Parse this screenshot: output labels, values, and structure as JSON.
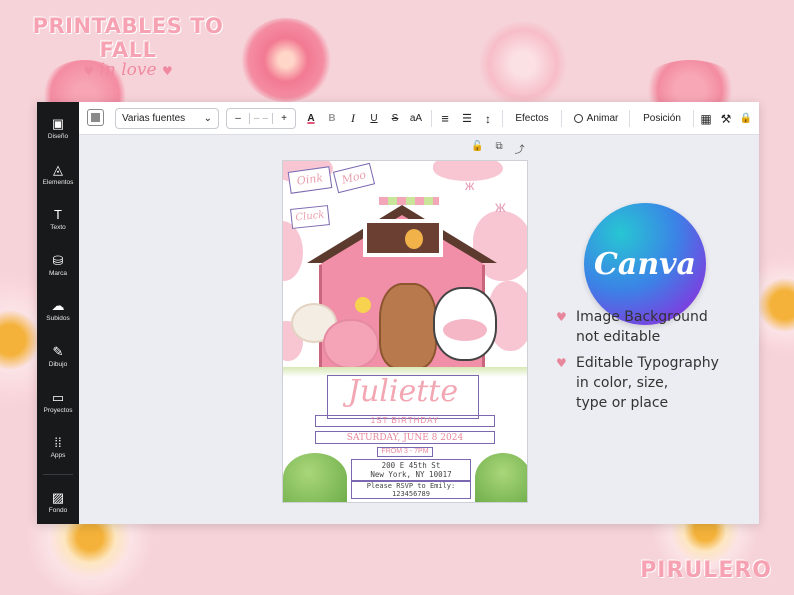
{
  "brand": {
    "line1": "PRINTABLES TO FALL",
    "line2": "in love",
    "heart": "♥"
  },
  "signature": "PIRULERO",
  "sidebar": {
    "items": [
      {
        "icon": "layout-icon",
        "glyph": "▣",
        "label": "Diseño"
      },
      {
        "icon": "shapes-icon",
        "glyph": "◬",
        "label": "Elementos"
      },
      {
        "icon": "text-icon",
        "glyph": "T",
        "label": "Texto"
      },
      {
        "icon": "brand-icon",
        "glyph": "⛁",
        "label": "Marca"
      },
      {
        "icon": "upload-icon",
        "glyph": "☁",
        "label": "Subidos"
      },
      {
        "icon": "draw-icon",
        "glyph": "✎",
        "label": "Dibujo"
      },
      {
        "icon": "folder-icon",
        "glyph": "▭",
        "label": "Proyectos"
      },
      {
        "icon": "apps-icon",
        "glyph": "⁞⁞",
        "label": "Apps"
      },
      {
        "icon": "background-icon",
        "glyph": "▨",
        "label": "Fondo"
      }
    ]
  },
  "toolbar": {
    "font": "Varias fuentes",
    "font_arrow": "⌄",
    "size_minus": "–",
    "size_value": "– –",
    "size_plus": "+",
    "text_color": "A",
    "bold": "B",
    "italic": "I",
    "underline": "U",
    "strike": "S",
    "case": "aA",
    "align": "≡",
    "list": "☰",
    "spacing": "↕",
    "effects": "Efectos",
    "animate": "Animar",
    "position": "Posición",
    "transparency": "▦",
    "style_paint": "⚒",
    "lock": "🔒"
  },
  "page_actions": {
    "lock": "🔓",
    "duplicate": "⧉",
    "add": "⤴"
  },
  "invitation": {
    "tags": [
      "Oink",
      "Moo",
      "Cluck"
    ],
    "name": "Juliette",
    "birthday": "1ST BIRTHDAY",
    "date": "SATURDAY, JUNE 8 2024",
    "time": "FROM 3 - 7PM",
    "address1": "200 E 45th St",
    "address2": "New York, NY 10017",
    "rsvp1": "Please RSVP to Emily:",
    "rsvp2": "123456789"
  },
  "canva_logo": "Canva",
  "features": [
    {
      "line1": "Image Background",
      "line2": "not editable"
    },
    {
      "line1": "Editable Typography",
      "line2": "in color, size,",
      "line3": "type or place"
    }
  ],
  "feature_bullet": "♥",
  "colors": {
    "pink": "#f6d3d9",
    "accent_pink": "#e7879b",
    "frame_purple": "#7b68b0",
    "sidebar": "#18191b"
  }
}
